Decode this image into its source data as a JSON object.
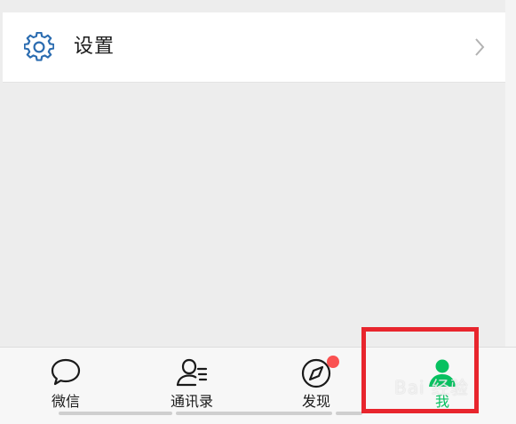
{
  "settings": {
    "label": "设置",
    "icon": "gear-icon",
    "chevron": "chevron-right-icon"
  },
  "tabbar": {
    "tabs": [
      {
        "label": "微信",
        "icon": "chat-bubble-icon",
        "active": false
      },
      {
        "label": "通讯录",
        "icon": "contacts-icon",
        "active": false
      },
      {
        "label": "发现",
        "icon": "compass-icon",
        "active": false,
        "badge": "red-dot"
      },
      {
        "label": "我",
        "icon": "person-icon",
        "active": true
      }
    ]
  },
  "watermark": {
    "text": "Bai 经验"
  },
  "colors": {
    "accent_green": "#07c160",
    "settings_blue": "#2b6cb0",
    "badge_red": "#fa5151",
    "highlight_red": "#e8252d",
    "background": "#ededed"
  }
}
